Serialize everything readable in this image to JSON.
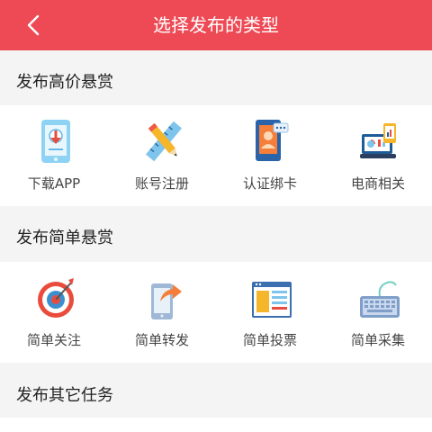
{
  "header": {
    "title": "选择发布的类型",
    "back_icon": "chevron-left-icon"
  },
  "sections": [
    {
      "title": "发布高价悬赏",
      "items": [
        {
          "label": "下载APP",
          "icon": "download-phone-icon"
        },
        {
          "label": "账号注册",
          "icon": "ruler-pencil-icon"
        },
        {
          "label": "认证绑卡",
          "icon": "id-card-phone-icon"
        },
        {
          "label": "电商相关",
          "icon": "laptop-chart-icon"
        }
      ]
    },
    {
      "title": "发布简单悬赏",
      "items": [
        {
          "label": "简单关注",
          "icon": "target-icon"
        },
        {
          "label": "简单转发",
          "icon": "share-phone-icon"
        },
        {
          "label": "简单投票",
          "icon": "browser-window-icon"
        },
        {
          "label": "简单采集",
          "icon": "keyboard-icon"
        }
      ]
    },
    {
      "title": "发布其它任务",
      "items": []
    }
  ],
  "colors": {
    "accent": "#ee4a55",
    "background": "#f4f4f4"
  }
}
